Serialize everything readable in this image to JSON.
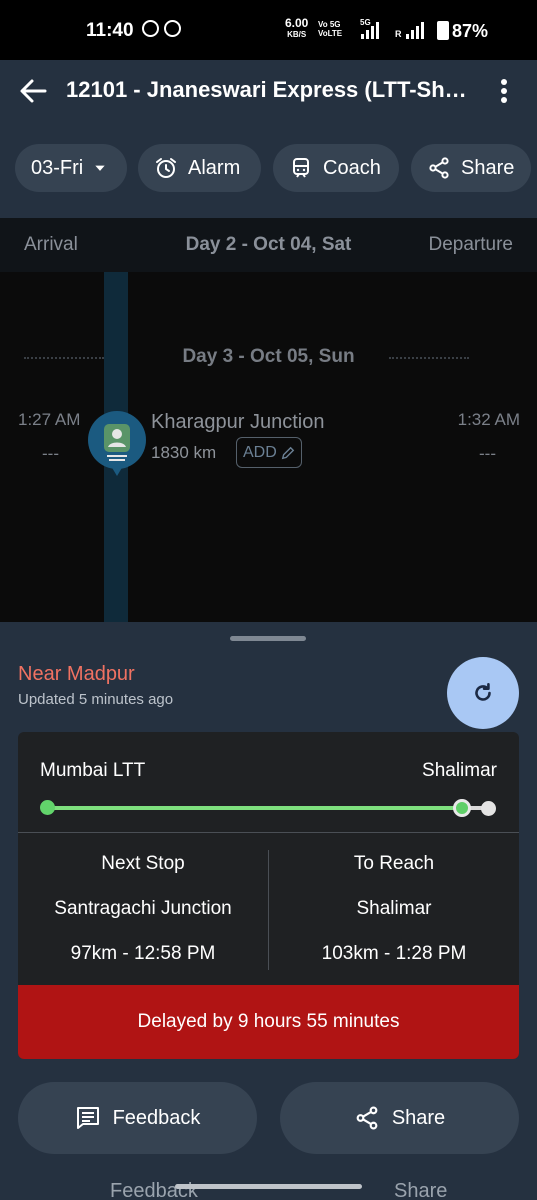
{
  "status_bar": {
    "time": "11:40",
    "net_speed": "6.00",
    "net_unit": "KB/S",
    "network_top": "Vo 5G",
    "network_bottom": "VoLTE",
    "network_5g": "5G",
    "roaming": "R",
    "battery": "87%"
  },
  "header": {
    "title": "12101 - Jnaneswari Express (LTT-Shalimar)",
    "chips": [
      {
        "label": "03-Fri",
        "icon": "chevron-down-icon"
      },
      {
        "label": "Alarm",
        "icon": "alarm-clock-icon"
      },
      {
        "label": "Coach",
        "icon": "train-icon"
      },
      {
        "label": "Share",
        "icon": "share-icon"
      }
    ]
  },
  "day_header": {
    "arrival": "Arrival",
    "day": "Day 2 - Oct 04, Sat",
    "departure": "Departure"
  },
  "timeline": {
    "day_divider": "Day 3 - Oct 05, Sun",
    "station": {
      "arrival": "1:27 AM",
      "arrival_delay": "---",
      "name": "Kharagpur Junction",
      "distance": "1830 km",
      "add_label": "ADD",
      "departure": "1:32 AM",
      "departure_delay": "---"
    }
  },
  "live_status": {
    "location": "Near Madpur",
    "updated": "Updated 5 minutes ago",
    "from": "Mumbai LTT",
    "to": "Shalimar",
    "progress_fraction": 0.94,
    "next_stop": {
      "heading": "Next Stop",
      "station": "Santragachi Junction",
      "eta": "97km - 12:58 PM"
    },
    "to_reach": {
      "heading": "To Reach",
      "station": "Shalimar",
      "eta": "103km - 1:28 PM"
    },
    "delay_text": "Delayed by 9 hours 55 minutes"
  },
  "actions": {
    "feedback": "Feedback",
    "share": "Share"
  },
  "colors": {
    "header_bg": "#253140",
    "chip_bg": "#364352",
    "location_text": "#f07262",
    "refresh_bg": "#a9c8f4",
    "progress_green": "#7ee07e",
    "delay_red": "#b01414"
  }
}
